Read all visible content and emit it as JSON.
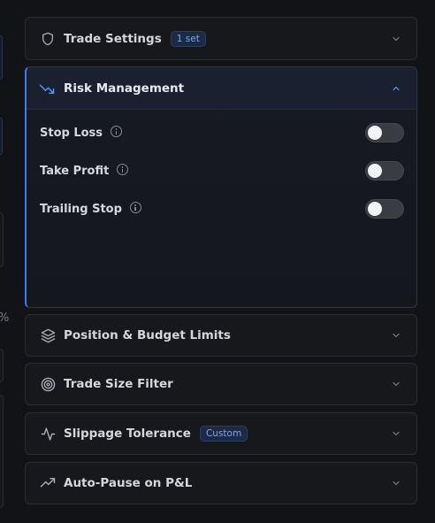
{
  "left_column": {
    "percent_fragment": "%"
  },
  "sections": [
    {
      "id": "trade-settings",
      "title": "Trade Settings",
      "badge": "1 set",
      "icon": "shield-icon",
      "expanded": false
    },
    {
      "id": "risk-management",
      "title": "Risk Management",
      "icon": "trending-down-icon",
      "expanded": true,
      "items": [
        {
          "label": "Stop Loss",
          "enabled": false
        },
        {
          "label": "Take Profit",
          "enabled": false
        },
        {
          "label": "Trailing Stop",
          "enabled": false
        }
      ]
    },
    {
      "id": "position-budget-limits",
      "title": "Position & Budget Limits",
      "icon": "layers-icon",
      "expanded": false
    },
    {
      "id": "trade-size-filter",
      "title": "Trade Size Filter",
      "icon": "target-icon",
      "expanded": false
    },
    {
      "id": "slippage-tolerance",
      "title": "Slippage Tolerance",
      "badge": "Custom",
      "icon": "activity-icon",
      "expanded": false
    },
    {
      "id": "auto-pause",
      "title": "Auto-Pause on P&L",
      "icon": "trending-up-icon",
      "expanded": false
    }
  ],
  "colors": {
    "accent": "#3f7bea",
    "badge_text": "#7fa3e6",
    "background": "#121316",
    "panel": "#17181c"
  }
}
